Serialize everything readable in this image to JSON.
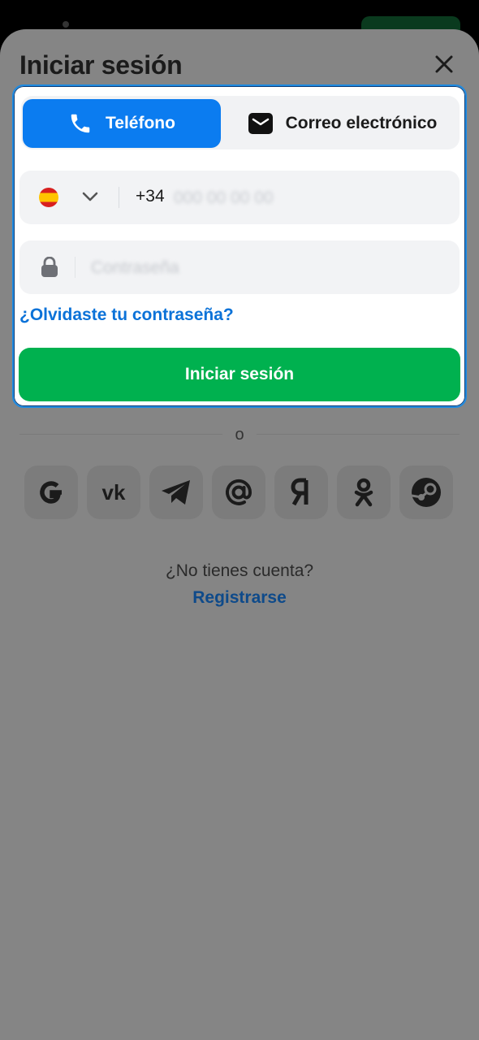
{
  "header": {
    "title": "Iniciar sesión"
  },
  "tabs": [
    {
      "label": "Teléfono",
      "icon": "phone-icon",
      "active": true
    },
    {
      "label": "Correo electrónico",
      "icon": "envelope-icon",
      "active": false
    }
  ],
  "phone": {
    "country_icon": "spain-flag-icon",
    "prefix": "+34",
    "placeholder": "000 00 00 00"
  },
  "password": {
    "icon": "lock-icon",
    "placeholder": "Contraseña"
  },
  "forgot_label": "¿Olvidaste tu contraseña?",
  "submit_label": "Iniciar sesión",
  "divider_label": "o",
  "social_providers": [
    "google-icon",
    "vk-icon",
    "telegram-icon",
    "mail-ru-icon",
    "yandex-icon",
    "odnoklassniki-icon",
    "steam-icon"
  ],
  "footer": {
    "question": "¿No tienes cuenta?",
    "register_label": "Registrarse"
  },
  "colors": {
    "accent_blue": "#0b7cf0",
    "link_blue": "#0b72d8",
    "submit_green": "#00b14f",
    "overlay_gray": "#858585"
  }
}
